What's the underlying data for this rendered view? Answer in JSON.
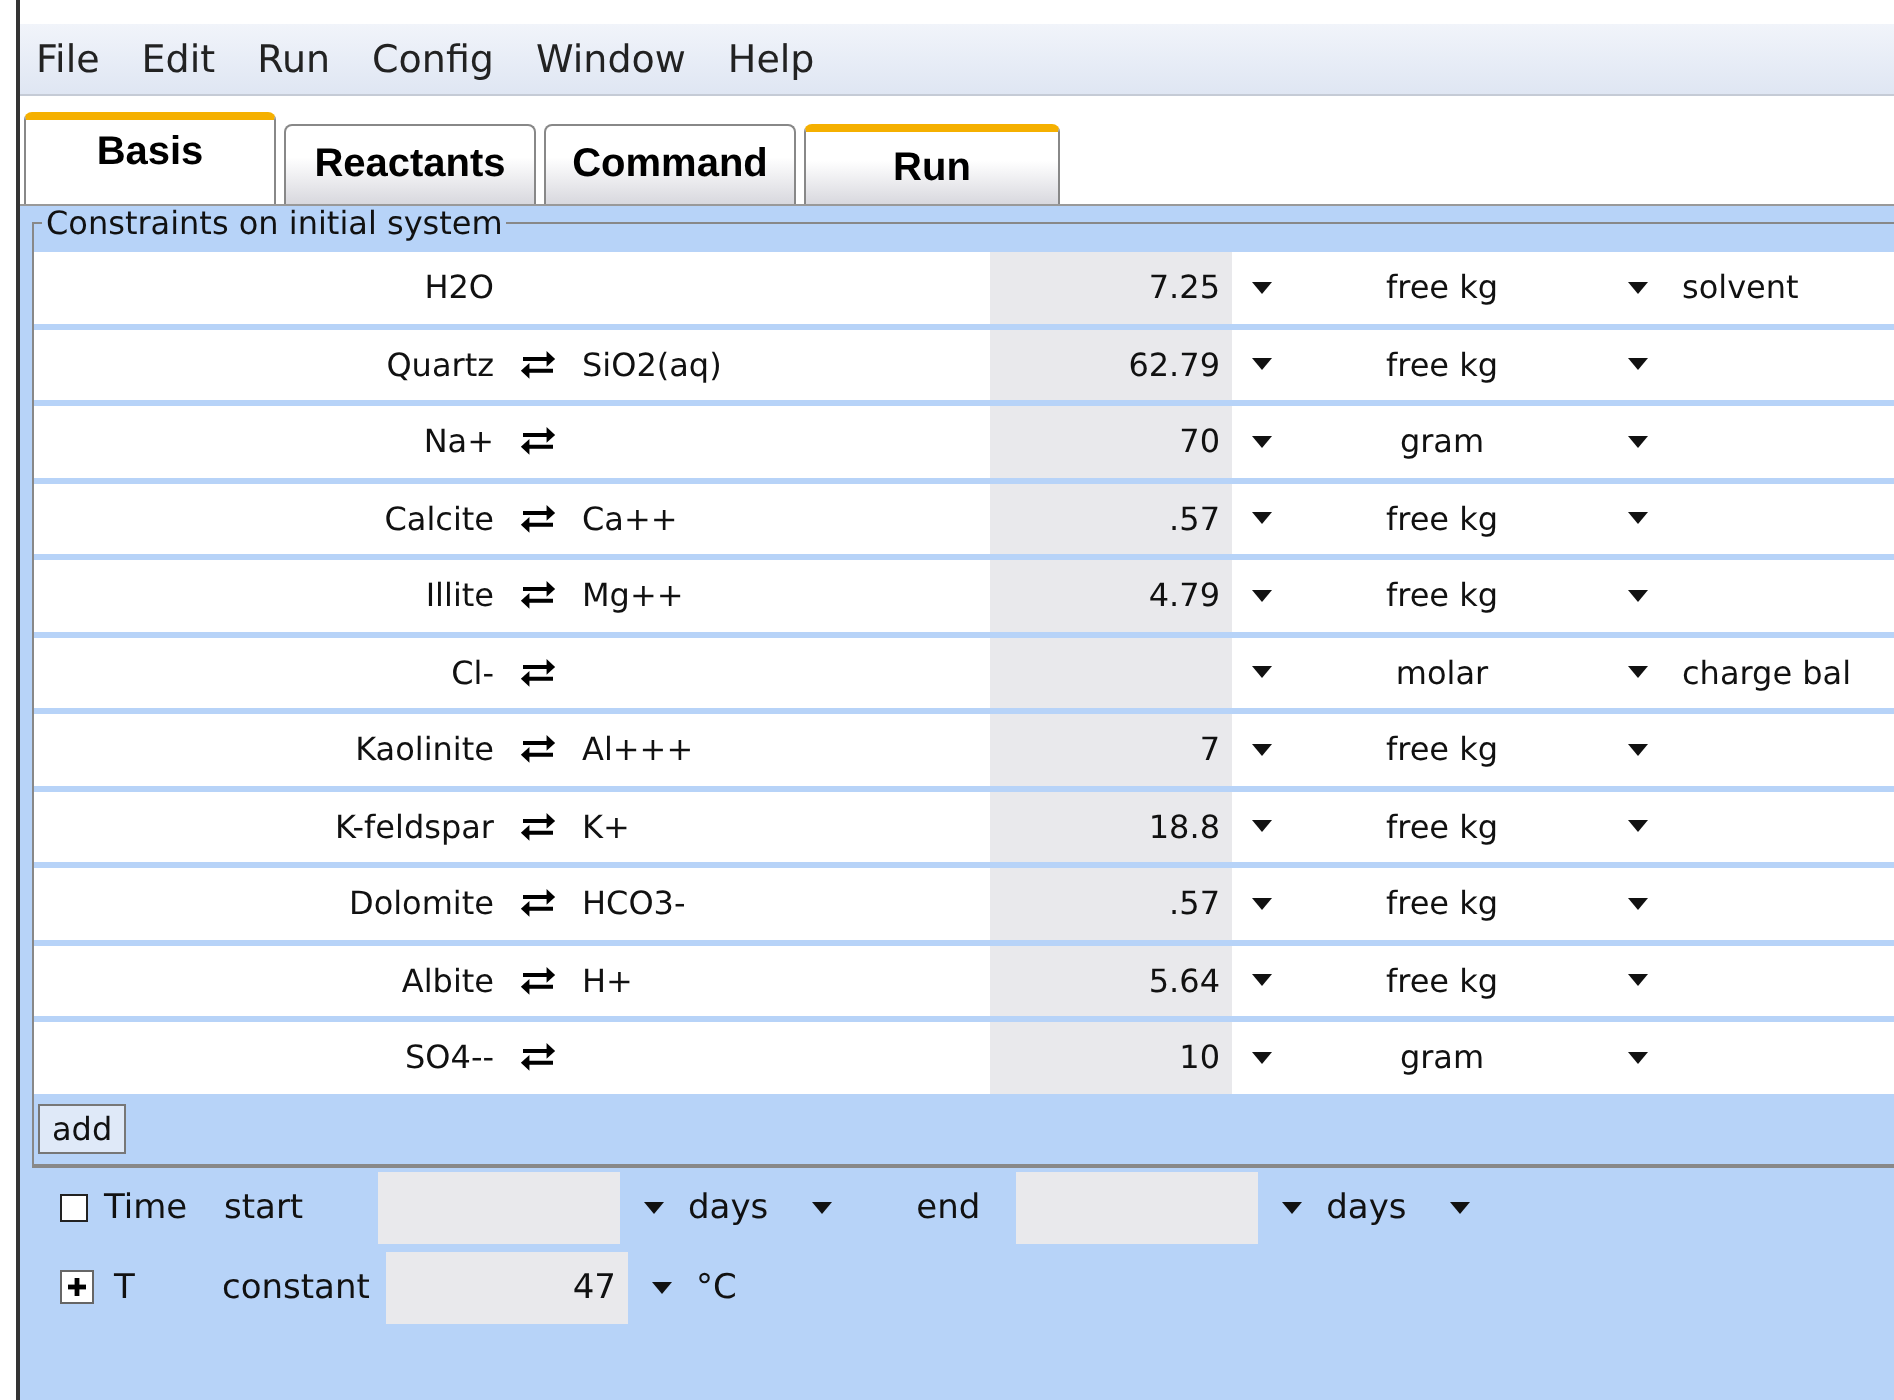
{
  "menu": [
    "File",
    "Edit",
    "Run",
    "Config",
    "Window",
    "Help"
  ],
  "tabs": [
    {
      "label": "Basis",
      "selected": true,
      "highlighted": true
    },
    {
      "label": "Reactants",
      "selected": false,
      "highlighted": false
    },
    {
      "label": "Command",
      "selected": false,
      "highlighted": false
    },
    {
      "label": "Run",
      "selected": false,
      "highlighted": true
    }
  ],
  "constraints": {
    "title": "Constraints on initial system",
    "rows": [
      {
        "name": "H2O",
        "swap": false,
        "value": "7.25",
        "unit": "free kg",
        "note": "solvent"
      },
      {
        "name": "Quartz",
        "swap": true,
        "swap_species": "SiO2(aq)",
        "value": "62.79",
        "unit": "free kg"
      },
      {
        "name": "Na+",
        "swap": true,
        "value": "70",
        "unit": "gram"
      },
      {
        "name": "Calcite",
        "swap": true,
        "swap_species": "Ca++",
        "value": ".57",
        "unit": "free kg"
      },
      {
        "name": "Illite",
        "swap": true,
        "swap_species": "Mg++",
        "value": "4.79",
        "unit": "free kg"
      },
      {
        "name": "Cl-",
        "swap": true,
        "unit": "molar",
        "note": "charge bal"
      },
      {
        "name": "Kaolinite",
        "swap": true,
        "swap_species": "Al+++",
        "value": "7",
        "unit": "free kg"
      },
      {
        "name": "K-feldspar",
        "swap": true,
        "swap_species": "K+",
        "value": "18.8",
        "unit": "free kg"
      },
      {
        "name": "Dolomite",
        "swap": true,
        "swap_species": "HCO3-",
        "value": ".57",
        "unit": "free kg"
      },
      {
        "name": "Albite",
        "swap": true,
        "swap_species": "H+",
        "value": "5.64",
        "unit": "free kg"
      },
      {
        "name": "SO4--",
        "swap": true,
        "value": "10",
        "unit": "gram"
      }
    ],
    "add_button": "add"
  },
  "time": {
    "checked": false,
    "label": "Time",
    "start_label": "start",
    "start_unit": "days",
    "end_label": "end",
    "end_unit": "days"
  },
  "temperature": {
    "expanded": false,
    "label": "T",
    "mode": "constant",
    "value": "47",
    "unit": "°C"
  }
}
